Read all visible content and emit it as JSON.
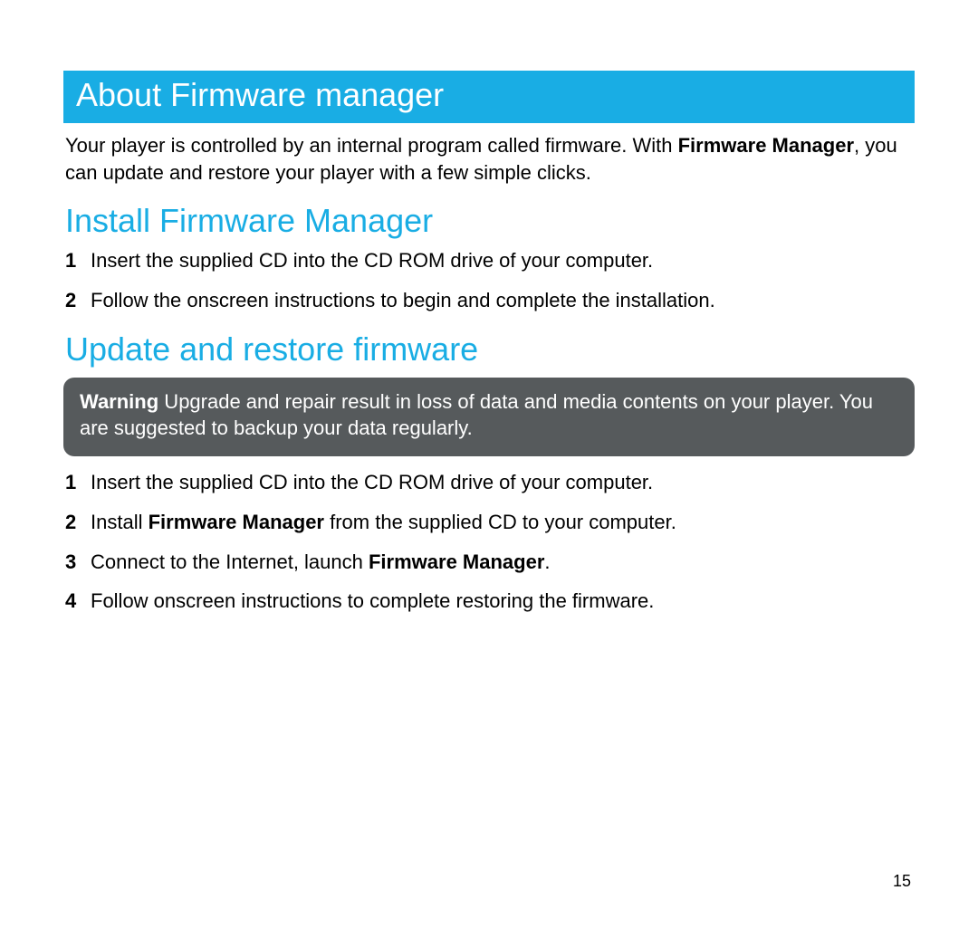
{
  "title": "About Firmware manager",
  "intro": {
    "pre": "Your player is controlled by an internal program called firmware. With ",
    "bold": "Firmware Manager",
    "post": ", you can update and restore your player with a few simple clicks."
  },
  "sections": {
    "install": {
      "heading": "Install Firmware Manager",
      "steps": [
        {
          "num": "1",
          "text": "Insert the supplied CD into the CD ROM drive of your computer."
        },
        {
          "num": "2",
          "text": "Follow the onscreen instructions to begin and complete the installation."
        }
      ]
    },
    "update": {
      "heading": "Update and restore firmware",
      "warning": {
        "label": "Warning",
        "text": " Upgrade and repair result in loss of data and media contents on your player. You are suggested to backup your data regularly."
      },
      "steps": [
        {
          "num": "1",
          "pre": "Insert the supplied CD into the CD ROM drive of your computer."
        },
        {
          "num": "2",
          "pre": "Install ",
          "bold": "Firmware Manager",
          "post": " from the supplied CD to your computer."
        },
        {
          "num": "3",
          "pre": "Connect to the Internet, launch ",
          "bold": "Firmware Manager",
          "post": "."
        },
        {
          "num": "4",
          "pre": "Follow onscreen instructions to complete restoring the firmware."
        }
      ]
    }
  },
  "page_number": "15"
}
